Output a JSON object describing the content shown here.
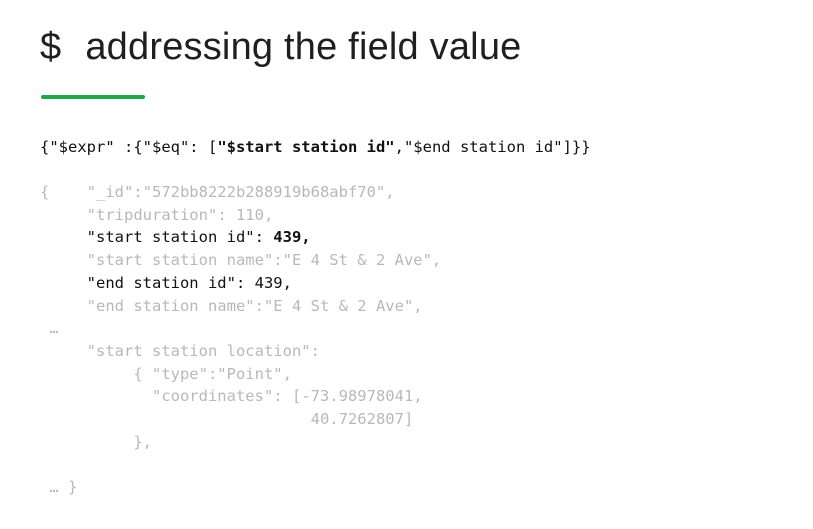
{
  "slide": {
    "title_symbol": "$",
    "title_text": "addressing the field value",
    "accent_color": "#21a64f"
  },
  "query": {
    "part1": "{\"$expr\" :{\"$eq\": [",
    "part2_bold": "\"$start station id\"",
    "part3": ",\"$end station id\"]}}"
  },
  "doc": {
    "line1": "{    \"_id\":\"572bb8222b288919b68abf70\",",
    "line2": "     \"tripduration\": 110,",
    "line3_key": "     \"start station id\": ",
    "line3_value": "439,",
    "line4": "     \"start station name\":\"E 4 St & 2 Ave\",",
    "line5": "     \"end station id\": 439,",
    "line6": "     \"end station name\":\"E 4 St & 2 Ave\",",
    "line7": " …",
    "line8": "     \"start station location\":",
    "line9": "          { \"type\":\"Point\",",
    "line10": "            \"coordinates\": [-73.98978041,",
    "line11": "                             40.7262807]",
    "line12": "          },",
    "line13": "",
    "line14": " … }"
  }
}
